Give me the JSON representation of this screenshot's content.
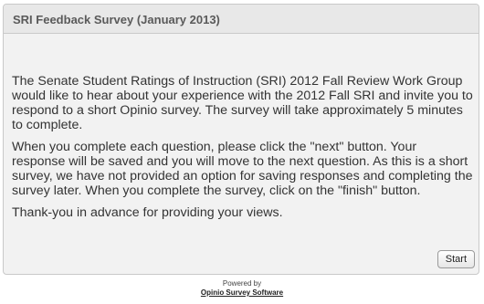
{
  "survey": {
    "title": "SRI Feedback Survey (January 2013)",
    "paragraphs": [
      "The Senate Student Ratings of Instruction (SRI) 2012 Fall Review Work Group would like to hear about your experience with the 2012 Fall SRI and invite you to respond to a short Opinio survey. The survey will take approximately 5 minutes to complete.",
      "When you complete each question, please click the \"next\" button. Your response will be saved and you will move to the next question. As this is a short survey, we have not provided an option for saving responses and completing the survey later. When you complete the survey, click on the \"finish\" button.",
      "Thank-you in advance for providing your views."
    ],
    "start_label": "Start"
  },
  "footer": {
    "powered_by": "Powered by",
    "link_text": "Opinio Survey Software"
  }
}
